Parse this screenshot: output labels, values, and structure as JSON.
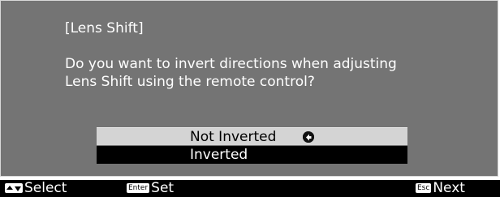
{
  "dialog": {
    "title": "[Lens Shift]",
    "message_line1": "Do you want to invert directions when adjusting",
    "message_line2": "Lens Shift using the remote control?",
    "options": [
      {
        "label": "Not Inverted",
        "selected": true
      },
      {
        "label": "Inverted",
        "selected": false
      }
    ]
  },
  "footer": {
    "select_label": "Select",
    "enter_key": "Enter",
    "set_label": "Set",
    "esc_key": "Esc",
    "next_label": "Next"
  },
  "icons": {
    "checked": "check-circle-icon",
    "nav_arrows": "up-down-arrow-icon"
  },
  "colors": {
    "dialog_bg": "#747474",
    "selected_bg": "#d4d4d4",
    "unselected_bg": "#000000",
    "footer_bg": "#000000"
  }
}
